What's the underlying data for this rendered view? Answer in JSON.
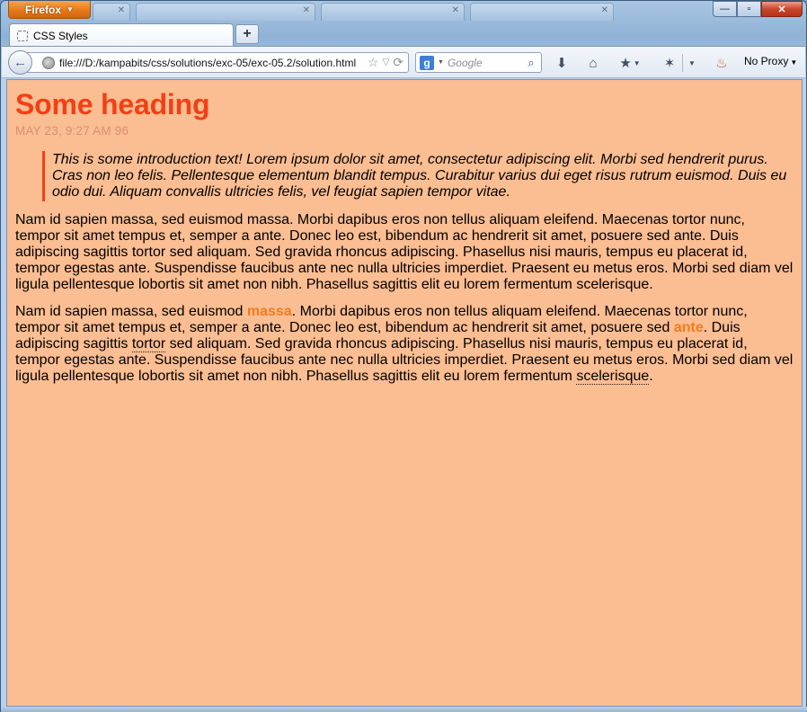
{
  "browser": {
    "app_button_label": "Firefox",
    "background_tabs": [
      "",
      "",
      "",
      ""
    ],
    "active_tab_title": "CSS Styles",
    "window_buttons": {
      "minimize": "—",
      "maximize": "▫",
      "close": "✕"
    },
    "url": "file:///D:/kampabits/css/solutions/exc-05/exc-05.2/solution.html",
    "search_placeholder": "Google",
    "proxy_label": "No Proxy"
  },
  "icons": {
    "back": "arrow-left-icon",
    "globe": "globe-icon",
    "bookmark_star": "star-icon",
    "reload": "reload-icon",
    "search_engine": "google-icon",
    "search": "magnifier-icon",
    "downloads": "download-arrow-icon",
    "home": "home-icon",
    "bookmarks": "bookmarks-icon",
    "addon": "bug-icon",
    "firebug": "flame-icon"
  },
  "colors": {
    "page_background": "#fbbd92",
    "heading": "#f43f14",
    "dateline": "#d9906a",
    "emphasis": "#f57b1f",
    "quote_border": "#f2421b"
  },
  "page": {
    "heading": "Some heading",
    "dateline": "MAY 23, 9:27 AM 96",
    "intro": "This is some introduction text! Lorem ipsum dolor sit amet, consectetur adipiscing elit. Morbi sed hendrerit purus. Cras non leo felis. Pellentesque elementum blandit tempus. Curabitur varius dui eget risus rutrum euismod. Duis eu odio dui. Aliquam convallis ultricies felis, vel feugiat sapien tempor vitae.",
    "paragraph1": "Nam id sapien massa, sed euismod massa. Morbi dapibus eros non tellus aliquam eleifend. Maecenas tortor nunc, tempor sit amet tempus et, semper a ante. Donec leo est, bibendum ac hendrerit sit amet, posuere sed ante. Duis adipiscing sagittis tortor sed aliquam. Sed gravida rhoncus adipiscing. Phasellus nisi mauris, tempus eu placerat id, tempor egestas ante. Suspendisse faucibus ante nec nulla ultricies imperdiet. Praesent eu metus eros. Morbi sed diam vel ligula pellentesque lobortis sit amet non nibh. Phasellus sagittis elit eu lorem fermentum scelerisque.",
    "paragraph2": {
      "s1": "Nam id sapien massa, sed euismod ",
      "em1": "massa",
      "s2": ". Morbi dapibus eros non tellus aliquam eleifend. Maecenas tortor nunc, tempor sit amet tempus et, semper a ante. Donec leo est, bibendum ac hendrerit sit amet, posuere sed ",
      "em2": "ante",
      "s3": ". Duis adipiscing sagittis ",
      "abbr1": "tortor",
      "s4": " sed aliquam. Sed gravida rhoncus adipiscing. Phasellus nisi mauris, tempus eu placerat id, tempor egestas ante. Suspendisse faucibus ante nec nulla ultricies imperdiet. Praesent eu metus eros. Morbi sed diam vel ligula pellentesque lobortis sit amet non nibh. Phasellus sagittis elit eu lorem fermentum ",
      "abbr2": "scelerisque",
      "s5": "."
    }
  }
}
